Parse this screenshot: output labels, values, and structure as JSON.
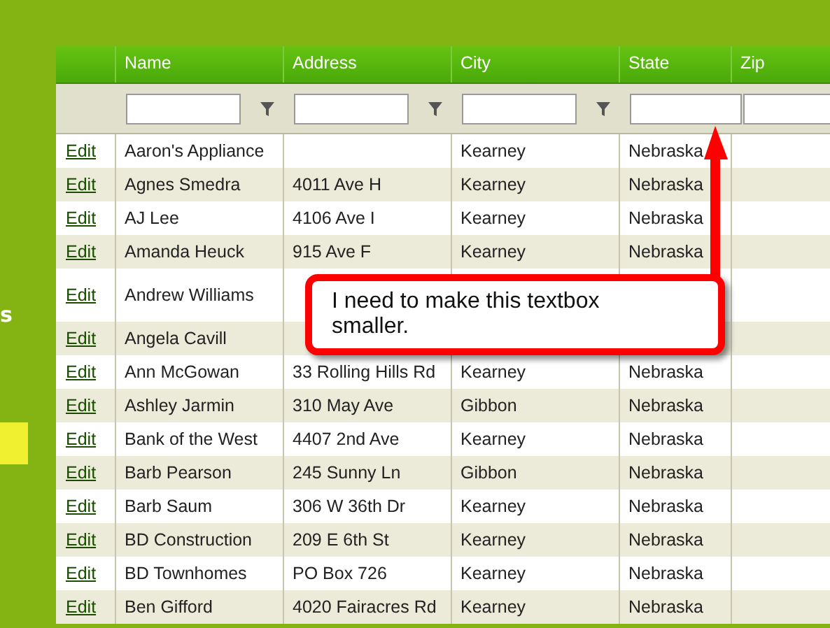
{
  "sidebar": {
    "text": "s",
    "highlight": true
  },
  "grid": {
    "columns": [
      "Name",
      "Address",
      "City",
      "State",
      "Zip"
    ],
    "filters": [
      {
        "has_menu": true
      },
      {
        "has_menu": true
      },
      {
        "has_menu": true
      },
      {
        "has_menu": false
      },
      {
        "has_menu": false
      }
    ],
    "rows": [
      {
        "action": "Edit",
        "name": "Aaron's Appliance",
        "city": "Kearney",
        "state": "Nebraska"
      },
      {
        "action": "Edit",
        "name": "Agnes Smedra",
        "address": "4011 Ave H",
        "city": "Kearney",
        "state": "Nebraska"
      },
      {
        "action": "Edit",
        "name": "AJ Lee",
        "address": "4106 Ave I",
        "city": "Kearney",
        "state": "Nebraska"
      },
      {
        "action": "Edit",
        "name": "Amanda Heuck",
        "address": "915 Ave F",
        "city": "Kearney",
        "state": "Nebraska"
      },
      {
        "action": "Edit",
        "name": "Andrew Williams",
        "tall": true
      },
      {
        "action": "Edit",
        "name": "Angela Cavill"
      },
      {
        "action": "Edit",
        "name": "Ann McGowan",
        "address": "33 Rolling Hills Rd",
        "city": "Kearney",
        "state": "Nebraska"
      },
      {
        "action": "Edit",
        "name": "Ashley Jarmin",
        "address": "310 May Ave",
        "city": "Gibbon",
        "state": "Nebraska"
      },
      {
        "action": "Edit",
        "name": "Bank of the West",
        "address": "4407 2nd Ave",
        "city": "Kearney",
        "state": "Nebraska"
      },
      {
        "action": "Edit",
        "name": "Barb Pearson",
        "address": "245 Sunny Ln",
        "city": "Gibbon",
        "state": "Nebraska"
      },
      {
        "action": "Edit",
        "name": "Barb Saum",
        "address": "306 W 36th Dr",
        "city": "Kearney",
        "state": "Nebraska"
      },
      {
        "action": "Edit",
        "name": "BD Construction",
        "address": "209 E 6th St",
        "city": "Kearney",
        "state": "Nebraska"
      },
      {
        "action": "Edit",
        "name": "BD Townhomes",
        "address": "PO Box 726",
        "city": "Kearney",
        "state": "Nebraska"
      },
      {
        "action": "Edit",
        "name": "Ben Gifford",
        "address": "4020 Fairacres Rd",
        "city": "Kearney",
        "state": "Nebraska"
      }
    ]
  },
  "callout": {
    "text": "I need to make this textbox smaller."
  }
}
